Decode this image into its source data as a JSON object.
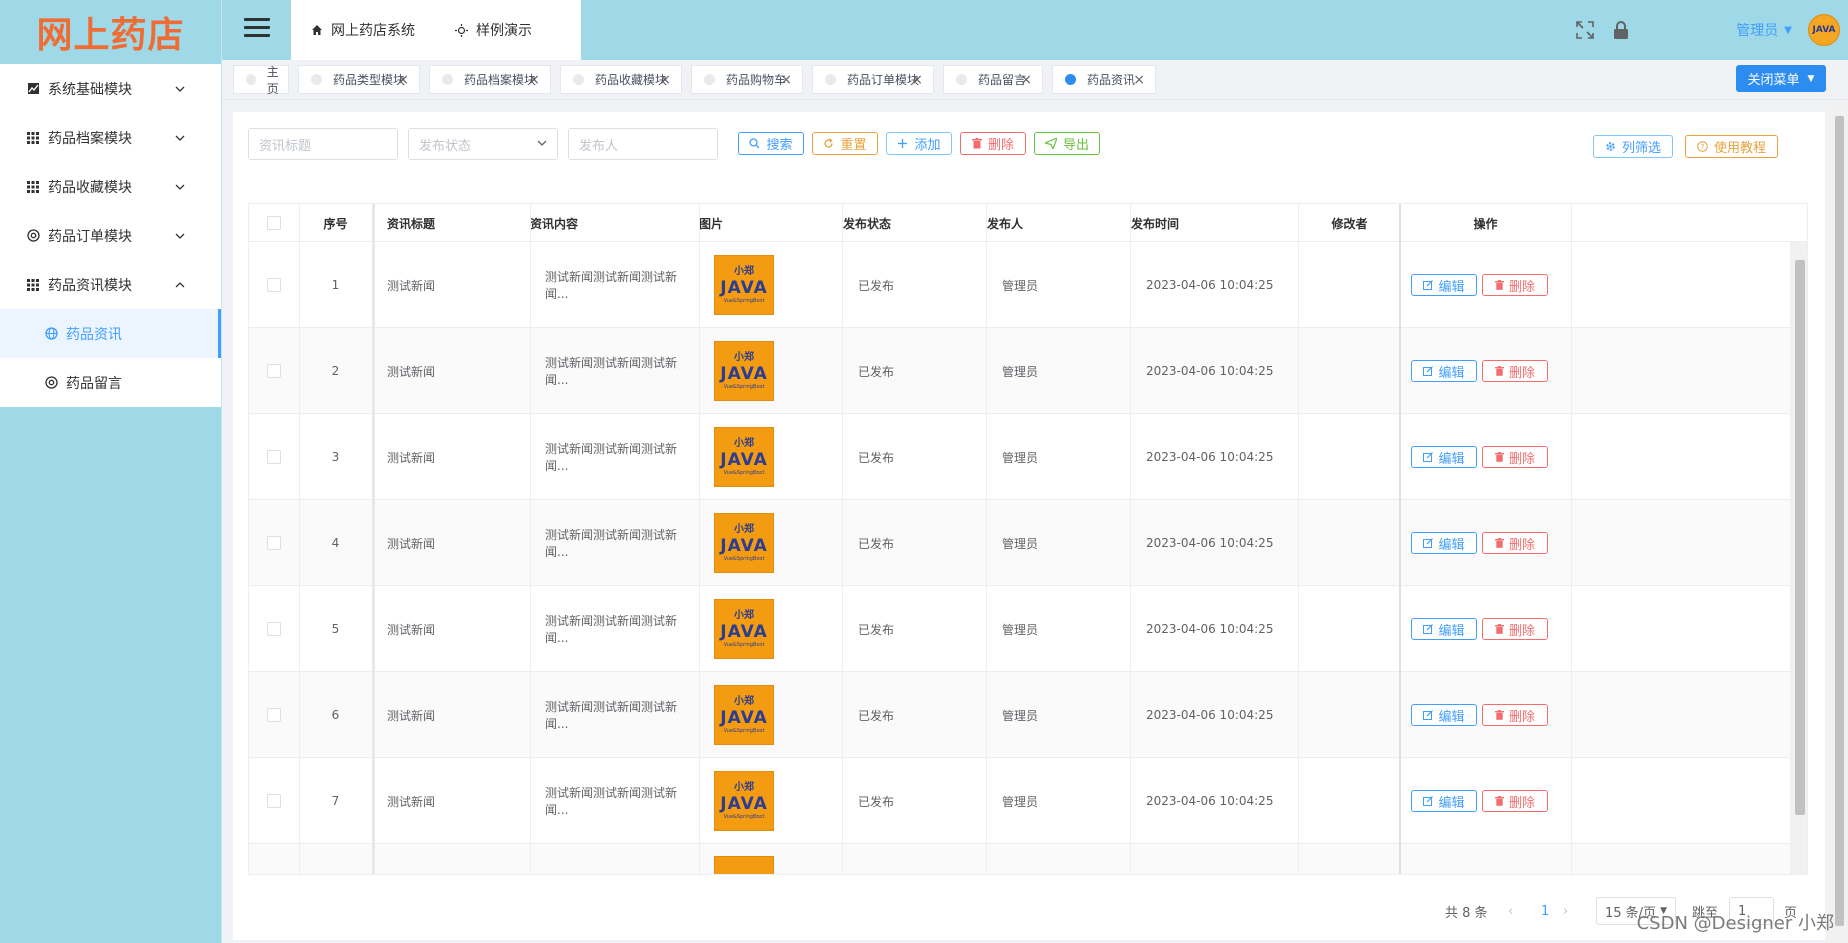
{
  "logo": {
    "text": "网上药店"
  },
  "sidebar": {
    "items": [
      {
        "label": "系统基础模块",
        "icon": "chart-icon",
        "expanded": false
      },
      {
        "label": "药品档案模块",
        "icon": "grid-icon",
        "expanded": false
      },
      {
        "label": "药品收藏模块",
        "icon": "grid-icon",
        "expanded": false
      },
      {
        "label": "药品订单模块",
        "icon": "settings-circle-icon",
        "expanded": false
      },
      {
        "label": "药品资讯模块",
        "icon": "grid-icon",
        "expanded": true
      }
    ],
    "subitems": [
      {
        "label": "药品资讯",
        "active": true
      },
      {
        "label": "药品留言",
        "active": false
      }
    ]
  },
  "header": {
    "nav": [
      {
        "label": "网上药店系统",
        "icon": "home-icon"
      },
      {
        "label": "样例演示",
        "icon": "sun-icon"
      }
    ],
    "user": "管理员",
    "avatar_text": "JAVA"
  },
  "tabs": [
    {
      "label": "主页",
      "closable": false,
      "active": false
    },
    {
      "label": "药品类型模块",
      "closable": true,
      "active": false
    },
    {
      "label": "药品档案模块",
      "closable": true,
      "active": false
    },
    {
      "label": "药品收藏模块",
      "closable": true,
      "active": false
    },
    {
      "label": "药品购物车",
      "closable": true,
      "active": false
    },
    {
      "label": "药品订单模块",
      "closable": true,
      "active": false
    },
    {
      "label": "药品留言",
      "closable": true,
      "active": false
    },
    {
      "label": "药品资讯",
      "closable": true,
      "active": true
    }
  ],
  "close_menu_label": "关闭菜单",
  "filters": {
    "title_placeholder": "资讯标题",
    "status_placeholder": "发布状态",
    "publisher_placeholder": "发布人"
  },
  "toolbar": {
    "search": "搜索",
    "reset": "重置",
    "add": "添加",
    "delete": "删除",
    "export": "导出",
    "column_filter": "列筛选",
    "tutorial": "使用教程"
  },
  "table": {
    "columns": [
      "序号",
      "资讯标题",
      "资讯内容",
      "图片",
      "发布状态",
      "发布人",
      "发布时间",
      "修改者",
      "操作"
    ],
    "rows": [
      {
        "no": "1",
        "title": "测试新闻",
        "content": "测试新闻测试新闻测试新闻...",
        "status": "已发布",
        "publisher": "管理员",
        "time": "2023-04-06 10:04:25",
        "modifier": ""
      },
      {
        "no": "2",
        "title": "测试新闻",
        "content": "测试新闻测试新闻测试新闻...",
        "status": "已发布",
        "publisher": "管理员",
        "time": "2023-04-06 10:04:25",
        "modifier": ""
      },
      {
        "no": "3",
        "title": "测试新闻",
        "content": "测试新闻测试新闻测试新闻...",
        "status": "已发布",
        "publisher": "管理员",
        "time": "2023-04-06 10:04:25",
        "modifier": ""
      },
      {
        "no": "4",
        "title": "测试新闻",
        "content": "测试新闻测试新闻测试新闻...",
        "status": "已发布",
        "publisher": "管理员",
        "time": "2023-04-06 10:04:25",
        "modifier": ""
      },
      {
        "no": "5",
        "title": "测试新闻",
        "content": "测试新闻测试新闻测试新闻...",
        "status": "已发布",
        "publisher": "管理员",
        "time": "2023-04-06 10:04:25",
        "modifier": ""
      },
      {
        "no": "6",
        "title": "测试新闻",
        "content": "测试新闻测试新闻测试新闻...",
        "status": "已发布",
        "publisher": "管理员",
        "time": "2023-04-06 10:04:25",
        "modifier": ""
      },
      {
        "no": "7",
        "title": "测试新闻",
        "content": "测试新闻测试新闻测试新闻...",
        "status": "已发布",
        "publisher": "管理员",
        "time": "2023-04-06 10:04:25",
        "modifier": ""
      }
    ],
    "edit_label": "编辑",
    "delete_label": "删除",
    "thumb": {
      "line1": "小郑",
      "line2": "JAVA",
      "line3": "Vue&SpringBoot"
    }
  },
  "pagination": {
    "total": "共 8 条",
    "current_page": "1",
    "page_size": "15 条/页",
    "jump_label": "跳至",
    "jump_value": "1",
    "page_suffix": "页"
  },
  "watermark": "CSDN @Designer 小郑",
  "colors": {
    "primary": "#409eff",
    "sidebar_bg": "#9fd8e6",
    "logo": "#ef6d34",
    "danger": "#f56c6c",
    "warning": "#e6a23c",
    "success": "#67c23a"
  }
}
